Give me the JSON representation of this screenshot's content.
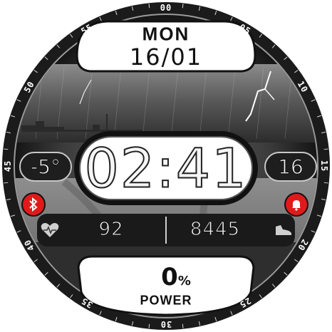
{
  "bezel": {
    "labels": [
      "00",
      "05",
      "10",
      "15",
      "20",
      "25",
      "30",
      "35",
      "40",
      "45",
      "50",
      "55"
    ]
  },
  "date": {
    "day": "MON",
    "date": "16/01"
  },
  "time": {
    "display": "02:41"
  },
  "weather": {
    "temperature": "-5°"
  },
  "side_right": {
    "value": "16"
  },
  "stats": {
    "heart_rate": "92",
    "steps": "8445"
  },
  "battery": {
    "percent_value": "0",
    "percent_sign": "%",
    "label": "POWER"
  },
  "icons": {
    "bluetooth": "bluetooth-icon",
    "alarm": "alarm-icon",
    "heart": "heart-rate-icon",
    "steps": "shoe-icon"
  },
  "colors": {
    "alert_red": "#e01a1a",
    "bezel": "#1b1b1b"
  }
}
